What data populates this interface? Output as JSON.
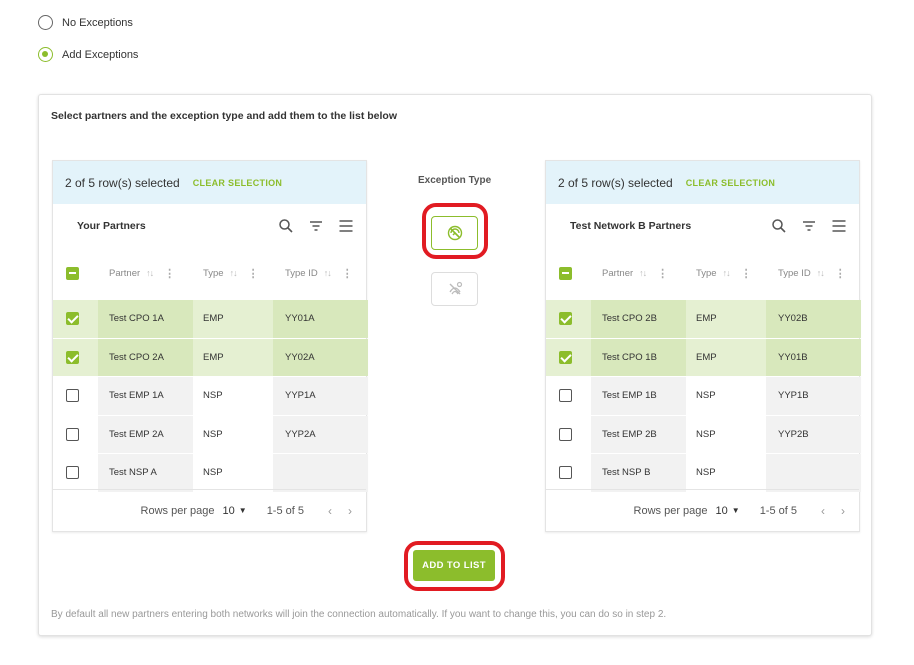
{
  "options": {
    "no_exceptions": "No Exceptions",
    "add_exceptions": "Add Exceptions",
    "selected": "add_exceptions"
  },
  "card": {
    "title": "Select partners and the exception type and add them to the list below",
    "note": "By default all new partners entering both networks will join the connection automatically. If you want to change this, you can do so in step 2."
  },
  "exception_type": {
    "label": "Exception Type",
    "buttons": [
      {
        "icon": "no-connection-icon",
        "active": true
      },
      {
        "icon": "no-connection-alt-icon",
        "active": false
      }
    ]
  },
  "add_button": "ADD TO LIST",
  "left_grid": {
    "selection": "2 of 5 row(s) selected",
    "clear": "CLEAR SELECTION",
    "title": "Your Partners",
    "columns": [
      "Partner",
      "Type",
      "Type ID"
    ],
    "rows": [
      {
        "partner": "Test CPO 1A",
        "type": "EMP",
        "type_id": "YY01A",
        "checked": true
      },
      {
        "partner": "Test CPO 2A",
        "type": "EMP",
        "type_id": "YY02A",
        "checked": true
      },
      {
        "partner": "Test EMP 1A",
        "type": "NSP",
        "type_id": "YYP1A",
        "checked": false
      },
      {
        "partner": "Test EMP 2A",
        "type": "NSP",
        "type_id": "YYP2A",
        "checked": false
      },
      {
        "partner": "Test NSP A",
        "type": "NSP",
        "type_id": "",
        "checked": false
      }
    ],
    "rows_per_page_label": "Rows per page",
    "rows_per_page": "10",
    "range": "1-5 of 5"
  },
  "right_grid": {
    "selection": "2 of 5 row(s) selected",
    "clear": "CLEAR SELECTION",
    "title": "Test Network B Partners",
    "columns": [
      "Partner",
      "Type",
      "Type ID"
    ],
    "rows": [
      {
        "partner": "Test CPO 2B",
        "type": "EMP",
        "type_id": "YY02B",
        "checked": true
      },
      {
        "partner": "Test CPO 1B",
        "type": "EMP",
        "type_id": "YY01B",
        "checked": true
      },
      {
        "partner": "Test EMP 1B",
        "type": "NSP",
        "type_id": "YYP1B",
        "checked": false
      },
      {
        "partner": "Test EMP 2B",
        "type": "NSP",
        "type_id": "YYP2B",
        "checked": false
      },
      {
        "partner": "Test NSP B",
        "type": "NSP",
        "type_id": "",
        "checked": false
      }
    ],
    "rows_per_page_label": "Rows per page",
    "rows_per_page": "10",
    "range": "1-5 of 5"
  },
  "colors": {
    "accent": "#8cbd2c",
    "selected_row": "#e5f0d2",
    "selected_row_alt": "#d8e8bc",
    "row_shade": "#f2f2f2",
    "highlight": "#e11b22"
  }
}
